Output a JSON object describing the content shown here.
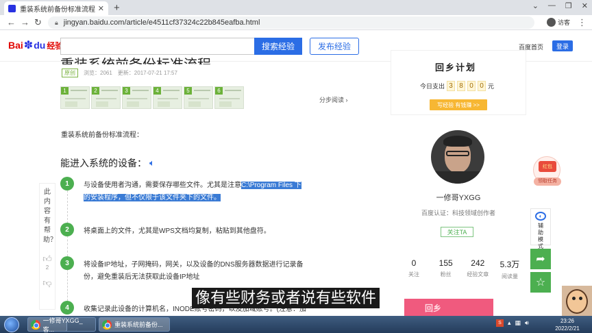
{
  "browser": {
    "tab_title": "重装系统前备份标准流程-百度经",
    "tab_close": "✕",
    "new_tab": "+",
    "url": "jingyan.baidu.com/article/e4511cf37324c22b845eafba.html",
    "profile_label": "访客",
    "win_controls": [
      "⌄",
      "—",
      "❐",
      "✕"
    ]
  },
  "header": {
    "logo_bai": "Bai",
    "logo_du": "du",
    "logo_jingyan": "经验",
    "search_placeholder": "",
    "search_button": "搜索经验",
    "publish_button": "发布经验",
    "home_link": "百度首页",
    "login_button": "登录"
  },
  "article": {
    "title": "重装系统前备份标准流程",
    "tag": "原创",
    "views": "浏览：2061",
    "updated": "更新：2017-07-21 17:57",
    "thumb_numbers": [
      "1",
      "2",
      "3",
      "4",
      "5",
      "6"
    ],
    "step_read": "分步阅读 ›",
    "intro": "重装系统前备份标准流程：",
    "section_title": "能进入系统的设备：",
    "steps": [
      {
        "num": "1",
        "text_a": "与设备使用者沟通，需要保存哪些文件。尤其是注意",
        "text_hl1": "C:\\Program Files 下",
        "text_hl2": "的安装程序，但不仅限于该文件夹下的文件。"
      },
      {
        "num": "2",
        "text": "将桌面上的文件，尤其是WPS文档均复制，粘贴到其他盘符。"
      },
      {
        "num": "3",
        "text": "将设备IP地址，子网掩码，网关，以及设备的DNS服务器数据进行记录备份，避免重装后无法获取此设备IP地址"
      },
      {
        "num": "4",
        "text": "收集记录此设备的计算机名，INODE账号密码，以及加域账号。(注意：加"
      }
    ]
  },
  "feedback": {
    "label": "此内容有帮助？",
    "like_count": "2",
    "like_icon": "thumbs-up",
    "dislike_icon": "thumbs-down"
  },
  "sidebar": {
    "banner_title": "回乡计划",
    "payout_prefix": "今日支出",
    "payout_digits": [
      "3",
      "8",
      "0",
      "0"
    ],
    "payout_unit": "元",
    "earn_button": "写经验 有钱赚 >>",
    "author_name": "一修哥YXGG",
    "certification": "百度认证：科技领域创作者",
    "follow_button": "关注TA",
    "stats": [
      {
        "value": "0",
        "label": "关注"
      },
      {
        "value": "155",
        "label": "粉丝"
      },
      {
        "value": "242",
        "label": "经验文章"
      },
      {
        "value": "5.3万",
        "label": "阅读量"
      }
    ],
    "ad_text": "回乡"
  },
  "floating": {
    "redpacket_label": "红包",
    "task_label": "领取任务",
    "assist_label": "辅助模式",
    "share_icon": "share-icon",
    "star_icon": "star-icon"
  },
  "subtitle": "像有些财务或者说有些软件",
  "taskbar": {
    "items": [
      "一修哥YXGG_客...",
      "重装系统前备份..."
    ],
    "tray_s": "S",
    "clock_time": "23:26",
    "clock_date": "2022/2/21"
  }
}
